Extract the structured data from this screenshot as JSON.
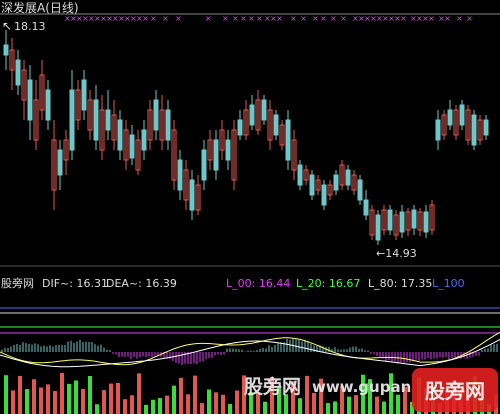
{
  "header": {
    "title": "深发展A(日线)"
  },
  "price_labels": {
    "high": "18.13",
    "low": "←14.93"
  },
  "indicator": {
    "name": "股旁网",
    "dif_label": "DIF~: 16.31",
    "dea_label": "DEA~: 16.39",
    "l00_label": "L_00: 16.44",
    "l20_label": "L_20: 16.67",
    "l80_label": "L_80: 17.35",
    "l100_label": "L_100"
  },
  "watermark": {
    "text1": "股旁网",
    "text2": "www.gupang.com",
    "logo": "股旁网"
  },
  "colors": {
    "bg": "#000000",
    "up": "#e0584f",
    "down": "#6fc7c9",
    "marker": "#e43cff",
    "l00": "#e43cff",
    "l20": "#44ff44",
    "l80": "#dddddd",
    "l100": "#4a6bff",
    "dif": "#ffff66",
    "dea": "#ffffff"
  },
  "icons": {
    "high_arrow": "arrow-up-left-icon",
    "low_arrow": "arrow-left-icon"
  }
}
